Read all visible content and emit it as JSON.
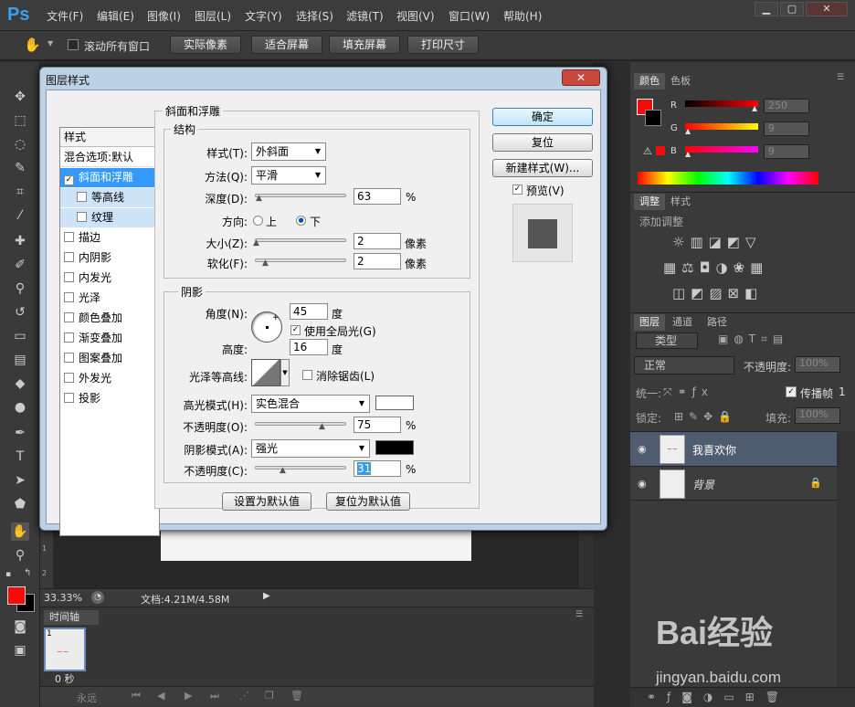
{
  "app": {
    "logo": "Ps"
  },
  "menu": [
    "文件(F)",
    "编辑(E)",
    "图像(I)",
    "图层(L)",
    "文字(Y)",
    "选择(S)",
    "滤镜(T)",
    "视图(V)",
    "窗口(W)",
    "帮助(H)"
  ],
  "options_bar": {
    "scroll_all": "滚动所有窗口",
    "buttons": [
      "实际像素",
      "适合屏幕",
      "填充屏幕",
      "打印尺寸"
    ]
  },
  "status": {
    "zoom": "33.33%",
    "doc": "文档:4.21M/4.58M"
  },
  "timeline": {
    "tab": "时间轴",
    "frame_no": "1",
    "frame_time": "0 秒",
    "loop": "永远"
  },
  "color_panel": {
    "tabs": [
      "颜色",
      "色板"
    ],
    "r": {
      "label": "R",
      "value": "250"
    },
    "g": {
      "label": "G",
      "value": "9"
    },
    "b": {
      "label": "B",
      "value": "9"
    },
    "fg_color": "#fa0909"
  },
  "adjust_panel": {
    "tabs": [
      "调整",
      "样式"
    ],
    "title": "添加调整"
  },
  "layers_panel": {
    "tabs": [
      "图层",
      "通道",
      "路径"
    ],
    "kind": "类型",
    "blend": "正常",
    "opacity_label": "不透明度:",
    "opacity": "100%",
    "unify": "统一:",
    "propagate": "传播帧",
    "propagate_value": "1",
    "lock_label": "锁定:",
    "fill_label": "填充:",
    "fill": "100%",
    "layers": [
      {
        "name": "我喜欢你"
      },
      {
        "name": "背景"
      }
    ]
  },
  "watermark": {
    "site": "jingyan.baidu.com",
    "brand": "Bai经验"
  },
  "dialog": {
    "title": "图层样式",
    "styles_header": "样式",
    "blend_options": "混合选项:默认",
    "style_items": [
      {
        "label": "斜面和浮雕",
        "checked": true
      },
      {
        "label": "等高线",
        "checked": false
      },
      {
        "label": "纹理",
        "checked": false
      },
      {
        "label": "描边",
        "checked": false
      },
      {
        "label": "内阴影",
        "checked": false
      },
      {
        "label": "内发光",
        "checked": false
      },
      {
        "label": "光泽",
        "checked": false
      },
      {
        "label": "颜色叠加",
        "checked": false
      },
      {
        "label": "渐变叠加",
        "checked": false
      },
      {
        "label": "图案叠加",
        "checked": false
      },
      {
        "label": "外发光",
        "checked": false
      },
      {
        "label": "投影",
        "checked": false
      }
    ],
    "section_title": "斜面和浮雕",
    "structure": {
      "title": "结构",
      "style_label": "样式(T):",
      "style_value": "外斜面",
      "technique_label": "方法(Q):",
      "technique_value": "平滑",
      "depth_label": "深度(D):",
      "depth_value": "63",
      "depth_unit": "%",
      "direction_label": "方向:",
      "dir_up": "上",
      "dir_down": "下",
      "size_label": "大小(Z):",
      "size_value": "2",
      "size_unit": "像素",
      "soften_label": "软化(F):",
      "soften_value": "2",
      "soften_unit": "像素"
    },
    "shading": {
      "title": "阴影",
      "angle_label": "角度(N):",
      "angle_value": "45",
      "angle_unit": "度",
      "global_light": "使用全局光(G)",
      "altitude_label": "高度:",
      "altitude_value": "16",
      "altitude_unit": "度",
      "gloss_label": "光泽等高线:",
      "anti_alias": "消除锯齿(L)",
      "highlight_label": "高光模式(H):",
      "highlight_value": "实色混合",
      "highlight_color": "#ffffff",
      "hl_opacity_label": "不透明度(O):",
      "hl_opacity_value": "75",
      "pct": "%",
      "shadow_label": "阴影模式(A):",
      "shadow_value": "强光",
      "shadow_color": "#000000",
      "sh_opacity_label": "不透明度(C):",
      "sh_opacity_value": "31"
    },
    "make_default": "设置为默认值",
    "reset_default": "复位为默认值",
    "ok": "确定",
    "reset": "复位",
    "new_style": "新建样式(W)...",
    "preview": "预览(V)"
  }
}
